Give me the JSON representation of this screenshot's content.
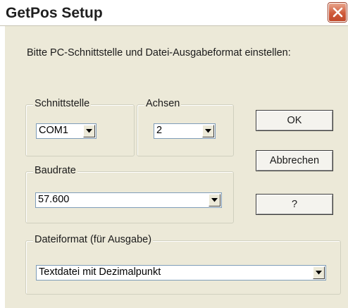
{
  "window": {
    "title": "GetPos Setup"
  },
  "instructions": "Bitte PC-Schnittstelle und Datei-Ausgabeformat einstellen:",
  "groups": {
    "schnittstelle": {
      "label": "Schnittstelle",
      "value": "COM1"
    },
    "achsen": {
      "label": "Achsen",
      "value": "2"
    },
    "baudrate": {
      "label": "Baudrate",
      "value": "57.600"
    },
    "dateiformat": {
      "label": "Dateiformat (für Ausgabe)",
      "value": "Textdatei mit Dezimalpunkt"
    }
  },
  "buttons": {
    "ok": "OK",
    "cancel": "Abbrechen",
    "help": "?"
  },
  "icons": {
    "close": "close-icon",
    "dropdown": "chevron-down-icon"
  },
  "colors": {
    "close_button": "#cf5b3b",
    "dialog_bg": "#ece9d8",
    "field_border": "#7f9db9"
  }
}
